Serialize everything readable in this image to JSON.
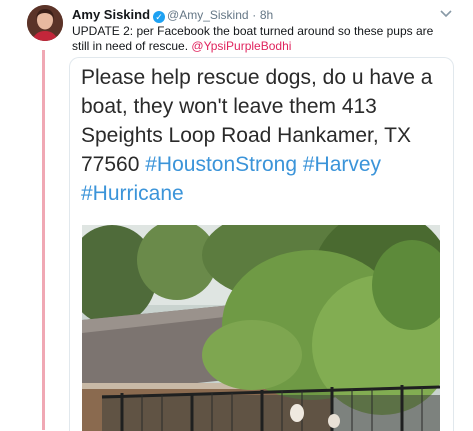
{
  "tweet": {
    "author_name": "Amy Siskind",
    "verified_icon": "verified-badge-icon",
    "handle": "@Amy_Siskind",
    "separator": "·",
    "time": "8h",
    "text_main": "UPDATE 2: per Facebook the boat turned around so these pups are still in need of rescue. ",
    "mention": "@YpsiPurpleBodhi",
    "menu_icon": "chevron-down-icon"
  },
  "embedded": {
    "text_main": "Please help rescue dogs, do u have a boat, they won't leave them 413 Speights Loop Road Hankamer, TX 77560 ",
    "hashtag_1": "#HoustonStrong",
    "hashtag_2": "#Harvey",
    "hashtag_3": "#Hurricane"
  },
  "colors": {
    "mention": "#e0245e",
    "hashtag": "#3b94d9",
    "thread_line": "#f0a8b4",
    "verified": "#1da1f2"
  }
}
